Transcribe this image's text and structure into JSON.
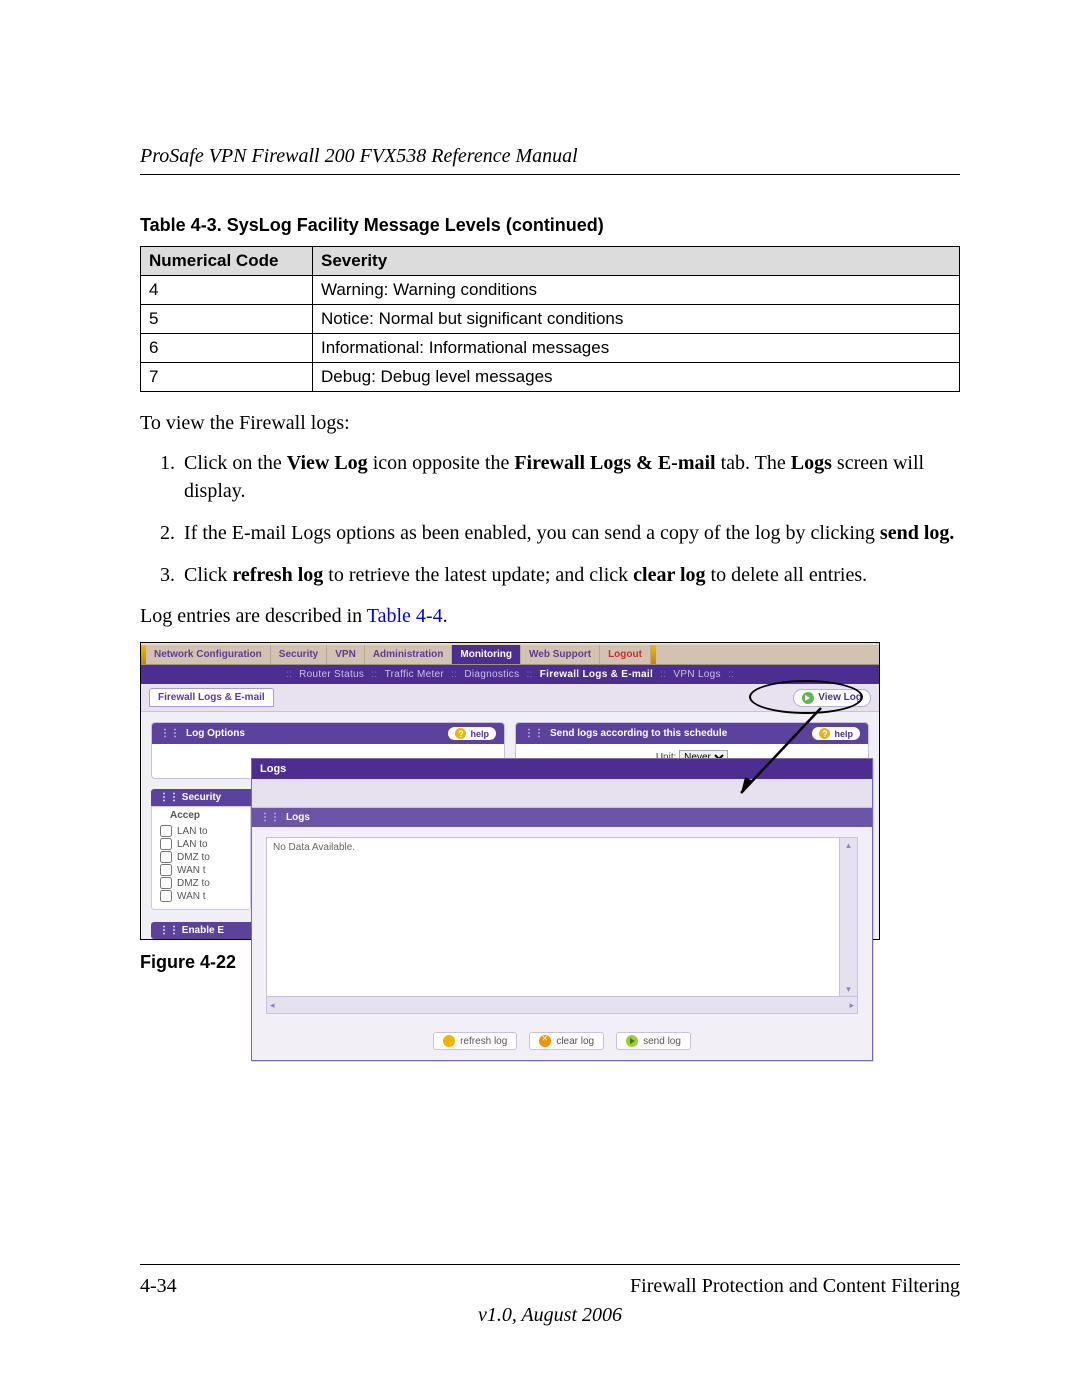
{
  "header": {
    "title": "ProSafe VPN Firewall 200 FVX538 Reference Manual"
  },
  "table": {
    "caption": "Table 4-3. SysLog Facility Message Levels (continued)",
    "columns": [
      "Numerical Code",
      "Severity"
    ],
    "rows": [
      {
        "code": "4",
        "severity": "Warning: Warning conditions"
      },
      {
        "code": "5",
        "severity": "Notice: Normal but significant conditions"
      },
      {
        "code": "6",
        "severity": "Informational: Informational messages"
      },
      {
        "code": "7",
        "severity": "Debug: Debug level messages"
      }
    ]
  },
  "text": {
    "intro": "To view the Firewall logs:",
    "step1_a": "Click on the ",
    "step1_b": "View Log",
    "step1_c": " icon opposite the ",
    "step1_d": "Firewall Logs & E-mail",
    "step1_e": " tab. The ",
    "step1_f": "Logs",
    "step1_g": " screen will display.",
    "step2_a": "If the E-mail Logs options as been enabled, you can send a copy of the log by clicking ",
    "step2_b": "send log.",
    "step3_a": "Click ",
    "step3_b": "refresh log",
    "step3_c": " to retrieve the latest update; and click ",
    "step3_d": "clear log",
    "step3_e": " to delete all entries.",
    "after_a": "Log entries are described in ",
    "after_link": "Table 4-4",
    "after_b": "."
  },
  "screenshot": {
    "top_nav": [
      "Network Configuration",
      "Security",
      "VPN",
      "Administration",
      "Monitoring",
      "Web Support",
      "Logout"
    ],
    "top_nav_selected_index": 4,
    "sub_nav": [
      "Router Status",
      "Traffic Meter",
      "Diagnostics",
      "Firewall Logs & E-mail",
      "VPN Logs"
    ],
    "sub_nav_selected_index": 3,
    "tab_label": "Firewall Logs & E-mail",
    "view_log_label": "View Log",
    "left_panel_title": "Log Options",
    "right_panel_title": "Send logs according to this schedule",
    "help_label": "help",
    "unit_label": "Unit:",
    "unit_options": [
      "Never"
    ],
    "unit_selected": "Never",
    "security_title": "Security",
    "accepts_label": "Accep",
    "accept_items": [
      "LAN to",
      "LAN to",
      "DMZ to",
      "WAN t",
      "DMZ to",
      "WAN t"
    ],
    "enable_title": "Enable E",
    "popup": {
      "title": "Logs",
      "panel_title": "Logs",
      "content": "No Data Available.",
      "buttons": {
        "refresh": "refresh log",
        "clear": "clear log",
        "send": "send log"
      }
    }
  },
  "figure_caption": "Figure 4-22",
  "footer": {
    "page": "4-34",
    "section": "Firewall Protection and Content Filtering",
    "version": "v1.0, August 2006"
  }
}
